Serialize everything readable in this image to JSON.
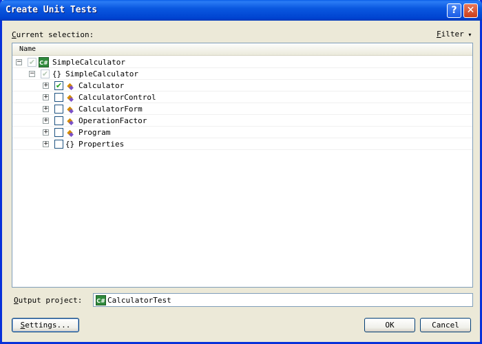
{
  "window": {
    "title": "Create Unit Tests",
    "help": "?",
    "close": "✕"
  },
  "selection": {
    "label_accel": "C",
    "label_rest": "urrent selection:",
    "filter_accel": "F",
    "filter_rest": "ilter",
    "filter_arrow": "▾"
  },
  "tree": {
    "column_name": "Name",
    "items": [
      {
        "label": "SimpleCalculator",
        "icon": "csharp-project-icon",
        "icon_text": "C#",
        "expander": "−",
        "checked": "✔",
        "state": "checked-disabled"
      },
      {
        "label": "SimpleCalculator",
        "icon": "namespace-icon",
        "icon_text": "{}",
        "expander": "−",
        "checked": "✔",
        "state": "checked-disabled"
      },
      {
        "label": "Calculator",
        "icon": "class-icon",
        "expander": "+",
        "checked": "✔",
        "state": "checked"
      },
      {
        "label": "CalculatorControl",
        "icon": "class-icon",
        "expander": "+",
        "checked": "",
        "state": "unchecked"
      },
      {
        "label": "CalculatorForm",
        "icon": "class-icon",
        "expander": "+",
        "checked": "",
        "state": "unchecked"
      },
      {
        "label": "OperationFactor",
        "icon": "class-icon",
        "expander": "+",
        "checked": "",
        "state": "unchecked"
      },
      {
        "label": "Program",
        "icon": "class-icon",
        "expander": "+",
        "checked": "",
        "state": "unchecked"
      },
      {
        "label": "Properties",
        "icon": "namespace-icon",
        "icon_text": "{}",
        "expander": "+",
        "checked": "",
        "state": "unchecked"
      }
    ]
  },
  "output": {
    "label_accel": "O",
    "label_rest": "utput project:",
    "value": "CalculatorTest",
    "icon_text": "C#"
  },
  "buttons": {
    "settings_accel": "S",
    "settings_rest": "ettings...",
    "ok": "OK",
    "cancel": "Cancel"
  },
  "colors": {
    "titlebar": "#0a58e0",
    "dialog_bg": "#ece9d8",
    "check_green": "#21a121"
  }
}
